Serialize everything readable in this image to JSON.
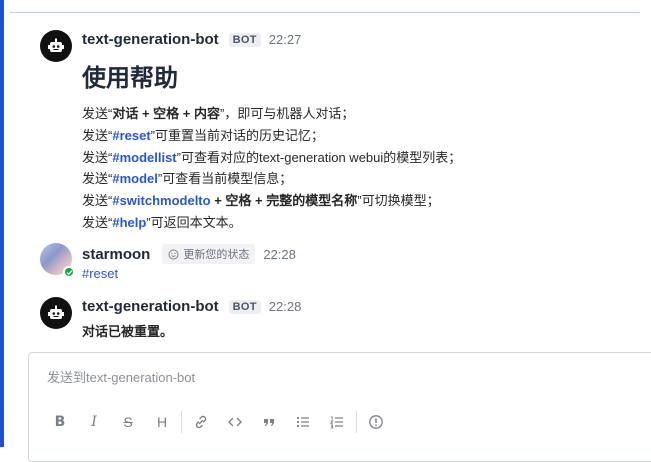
{
  "messages": [
    {
      "author": "text-generation-bot",
      "badge": "BOT",
      "time": "22:27",
      "title": "使用帮助",
      "lines": [
        {
          "p1": "发送“",
          "s1": "对话 + 空格 + 内容",
          "p2": "”，即可与机器人对话；"
        },
        {
          "p1": "发送“",
          "k1": "#reset",
          "p2": "”可重置当前对话的历史记忆；"
        },
        {
          "p1": "发送“",
          "k1": "#modellist",
          "p2": "”可查看对应的text-generation webui的模型列表；"
        },
        {
          "p1": "发送“",
          "k1": "#model",
          "p2": "”可查看当前模型信息；"
        },
        {
          "p1": "发送“",
          "k1": "#switchmodelto",
          "s1": " + 空格 + 完整的模型名称",
          "p2": "”可切换模型；"
        },
        {
          "p1": "发送“",
          "k1": "#help",
          "p2": "”可返回本文本。"
        }
      ]
    },
    {
      "author": "starmoon",
      "status_chip": "更新您的状态",
      "time": "22:28",
      "text": "#reset"
    },
    {
      "author": "text-generation-bot",
      "badge": "BOT",
      "time": "22:28",
      "text": "对话已被重置。"
    }
  ],
  "composer": {
    "placeholder": "发送到text-generation-bot",
    "toolbar": [
      "bold-icon",
      "italic-icon",
      "strikethrough-icon",
      "heading-icon",
      "link-icon",
      "code-icon",
      "quote-icon",
      "bullet-list-icon",
      "numbered-list-icon",
      "info-icon"
    ],
    "bold": "B",
    "italic": "I",
    "strike": "S",
    "heading": "H"
  },
  "colors": {
    "accent": "#1e4fd6",
    "link": "#2a57c4",
    "online": "#16a34a"
  }
}
